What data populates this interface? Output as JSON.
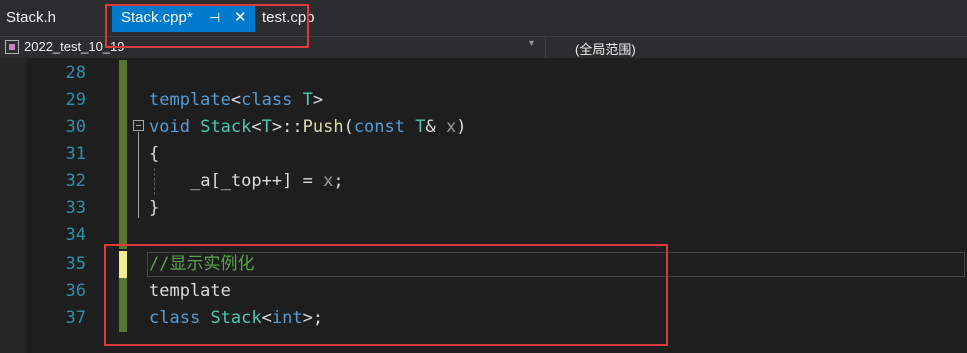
{
  "tabs": {
    "stack_h": "Stack.h",
    "active": "Stack.cpp*",
    "pin_glyph": "⊣",
    "close_glyph": "✕",
    "test_cpp": "test.cpp"
  },
  "navbar": {
    "project": "2022_test_10_19",
    "scope": "(全局范围)",
    "dropdown_glyph": "▾"
  },
  "editor": {
    "lines": [
      {
        "num": "28",
        "code": ""
      },
      {
        "num": "29",
        "code": "template<class T>"
      },
      {
        "num": "30",
        "code": "void Stack<T>::Push(const T& x)"
      },
      {
        "num": "31",
        "code": "{"
      },
      {
        "num": "32",
        "code": "    _a[_top++] = x;"
      },
      {
        "num": "33",
        "code": "}"
      },
      {
        "num": "34",
        "code": ""
      },
      {
        "num": "35",
        "code": "//显示实例化"
      },
      {
        "num": "36",
        "code": "template"
      },
      {
        "num": "37",
        "code": "class Stack<int>;"
      }
    ]
  },
  "colors": {
    "keyword": "#569cd6",
    "type": "#4ec9b0",
    "function": "#dcdcaa",
    "param": "#9a9a9a",
    "comment": "#57a64a",
    "accent": "#007acc",
    "annotation_box": "#e0393e"
  }
}
